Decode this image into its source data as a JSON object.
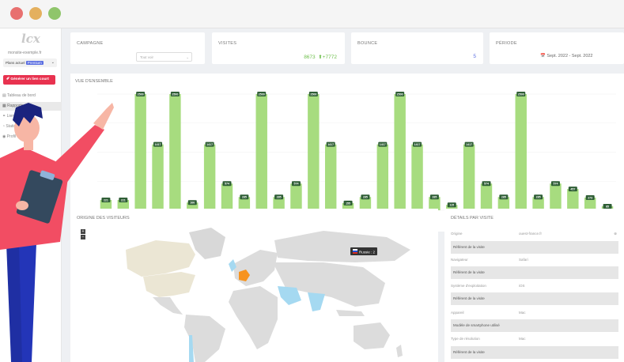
{
  "window": {
    "controls": [
      {
        "name": "close",
        "color": "#e8706f"
      },
      {
        "name": "minimize",
        "color": "#e4b05e"
      },
      {
        "name": "maximize",
        "color": "#8fc56b"
      }
    ]
  },
  "sidebar": {
    "logo": "lcx",
    "site_url": "monsite-exemple.fr",
    "plan_prefix": "Plans actuel",
    "plan_tag": "Premium",
    "cta_label": "Générer un lien court",
    "items": [
      {
        "label": "Tableau de bord"
      },
      {
        "label": "Rapports"
      },
      {
        "label": "Liens"
      },
      {
        "label": "Statistiques"
      },
      {
        "label": "Profil"
      }
    ]
  },
  "stats": {
    "campaign": {
      "label": "CAMPAGNE",
      "select_value": "Tout voir"
    },
    "visits": {
      "label": "VISITES",
      "value": "8673",
      "delta": "+7772"
    },
    "bounce": {
      "label": "BOUNCE",
      "value": "5"
    },
    "period": {
      "label": "PÉRIODE",
      "value": "Sept. 2022 - Sept. 2022"
    }
  },
  "chart_title": "VUE D'ENSEMBLE",
  "chart_data": {
    "type": "bar",
    "title": "VUE D'ENSEMBLE",
    "ylim": [
      0,
      2500
    ],
    "values": [
      221,
      221,
      2500,
      1417,
      2500,
      166,
      1417,
      574,
      285,
      2500,
      285,
      574,
      2500,
      1417,
      155,
      285,
      1417,
      2500,
      1417,
      285,
      115,
      1417,
      574,
      285,
      2500,
      285,
      574,
      457,
      273,
      85
    ],
    "color": "#a7dc7f",
    "label_color": "#2f5e36"
  },
  "map": {
    "title": "ORIGINE DES VISITEURS",
    "tooltip": "Russie : 2",
    "zoom_in": "+",
    "zoom_out": "−"
  },
  "details": {
    "title": "DÉTAILS PAR VISITE",
    "rows": [
      {
        "label": "Origine",
        "value": "ouest-france.fr",
        "box": "Référent de la visite"
      },
      {
        "label": "Navigateur",
        "value": "Safari",
        "box": "Référent de la visite"
      },
      {
        "label": "Système d'exploitation",
        "value": "iOS",
        "box": "Référent de la visite"
      },
      {
        "label": "Appareil",
        "value": "Mac",
        "box": "Modèle de smartphone utilisé"
      },
      {
        "label": "Type de résolution",
        "value": "Mac",
        "box": "Référent de la visite"
      }
    ]
  }
}
